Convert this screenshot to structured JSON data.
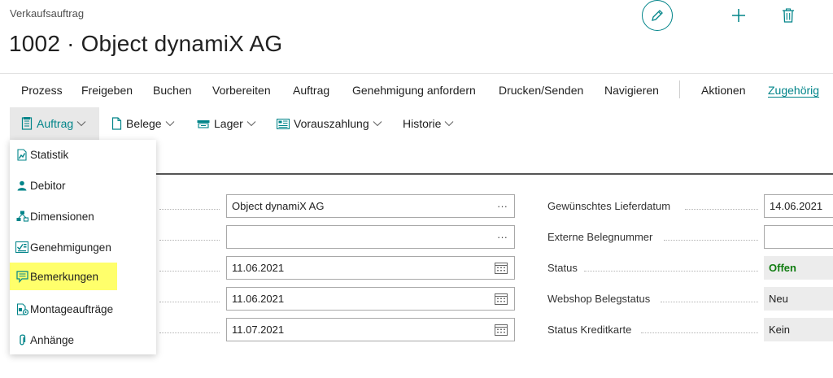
{
  "header": {
    "breadcrumb": "Verkaufsauftrag",
    "title": "1002 · Object dynamiX AG"
  },
  "top_actions": [
    {
      "name": "edit",
      "icon": "pencil-icon"
    },
    {
      "name": "new",
      "icon": "plus-icon"
    },
    {
      "name": "delete",
      "icon": "trash-icon"
    }
  ],
  "action_bar": {
    "items": [
      "Prozess",
      "Freigeben",
      "Buchen",
      "Vorbereiten",
      "Auftrag",
      "Genehmigung anfordern",
      "Drucken/Senden",
      "Navigieren",
      "Aktionen",
      "Zugehörig"
    ],
    "active": "Zugehörig"
  },
  "sub_bar": {
    "items": [
      {
        "label": "Auftrag",
        "icon": "document-icon"
      },
      {
        "label": "Belege",
        "icon": "page-icon"
      },
      {
        "label": "Lager",
        "icon": "warehouse-icon"
      },
      {
        "label": "Vorauszahlung",
        "icon": "invoice-icon"
      },
      {
        "label": "Historie",
        "icon": ""
      }
    ],
    "open": "Auftrag"
  },
  "dropdown": {
    "items": [
      {
        "label": "Statistik",
        "icon": "chart-icon"
      },
      {
        "label": "Debitor",
        "icon": "person-icon"
      },
      {
        "label": "Dimensionen",
        "icon": "dimensions-icon"
      },
      {
        "label": "Genehmigungen",
        "icon": "approvals-icon"
      },
      {
        "label": "Bemerkungen",
        "icon": "comment-icon",
        "highlighted": true
      },
      {
        "label": "Montageaufträge",
        "icon": "assembly-icon"
      },
      {
        "label": "Anhänge",
        "icon": "paperclip-icon"
      }
    ],
    "highlight_color": "#ffff6b"
  },
  "left_fields": [
    {
      "value": "Object dynamiX AG",
      "suffix": "···"
    },
    {
      "value": "",
      "suffix": "···"
    },
    {
      "value": "11.06.2021",
      "suffix": "calendar-icon"
    },
    {
      "value": "11.06.2021",
      "suffix": "calendar-icon"
    },
    {
      "value": "11.07.2021",
      "suffix": "calendar-icon"
    }
  ],
  "right_fields": [
    {
      "label": "Gewünschtes Lieferdatum",
      "value": "14.06.2021",
      "kind": "input"
    },
    {
      "label": "Externe Belegnummer",
      "value": "",
      "kind": "input"
    },
    {
      "label": "Status",
      "value": "Offen",
      "kind": "readonly-green"
    },
    {
      "label": "Webshop Belegstatus",
      "value": "Neu",
      "kind": "readonly"
    },
    {
      "label": "Status Kreditkarte",
      "value": "Kein",
      "kind": "readonly"
    }
  ],
  "colors": {
    "accent": "#008489",
    "status_green": "#107c10"
  }
}
